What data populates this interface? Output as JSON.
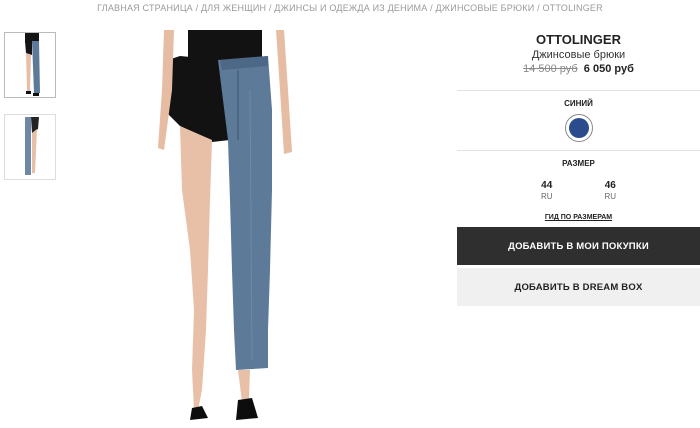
{
  "breadcrumb": "ГЛАВНАЯ СТРАНИЦА / ДЛЯ ЖЕНЩИН / ДЖИНСЫ И ОДЕЖДА ИЗ ДЕНИМА / ДЖИНСОВЫЕ БРЮКИ / OTTOLINGER",
  "product": {
    "brand": "OTTOLINGER",
    "name": "Джинсовые брюки",
    "old_price": "14 500 руб",
    "new_price": "6 050 руб"
  },
  "color": {
    "label": "СИНИЙ",
    "swatch_hex": "#2b4c8c"
  },
  "size": {
    "label": "РАЗМЕР",
    "options": [
      {
        "value": "44",
        "region": "RU"
      },
      {
        "value": "46",
        "region": "RU"
      }
    ],
    "guide_link": "ГИД ПО РАЗМЕРАМ"
  },
  "actions": {
    "add_to_cart": "ДОБАВИТЬ В МОИ ПОКУПКИ",
    "add_to_dreambox": "ДОБАВИТЬ В DREAM BOX"
  },
  "gallery": {
    "thumbnails": [
      "front-view",
      "back-view"
    ],
    "active_index": 0
  },
  "colors": {
    "denim": "#5d7a99",
    "bodysuit": "#121212",
    "primary_button": "#2f2f2f",
    "secondary_button": "#f0f0f0"
  }
}
